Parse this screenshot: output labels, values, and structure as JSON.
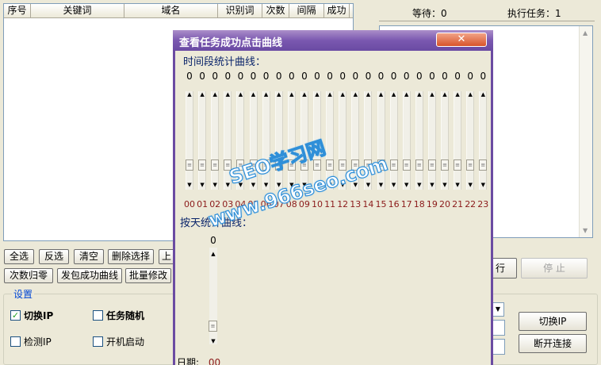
{
  "list": {
    "columns": [
      "序号",
      "关键词",
      "域名",
      "识别词",
      "次数",
      "间隔",
      "成功"
    ]
  },
  "status": {
    "waiting_label": "等待：0",
    "executing_label": "执行任务：1"
  },
  "buttons": {
    "select_all": "全选",
    "invert": "反选",
    "clear": "清空",
    "delete_selected": "删除选择",
    "up_partial": "上",
    "reset_count": "次数归零",
    "send_curve": "发包成功曲线",
    "batch_edit": "批量修改",
    "run_partial": "行",
    "stop": "停 止",
    "switch_ip": "切换IP",
    "disconnect": "断开连接"
  },
  "settings": {
    "title": "设置",
    "switch_ip": {
      "label": "切换IP",
      "checked": true
    },
    "task_random": {
      "label": "任务随机",
      "checked": false
    },
    "detect_ip": {
      "label": "检测IP",
      "checked": false
    },
    "autostart": {
      "label": "开机启动",
      "checked": false
    }
  },
  "dialog": {
    "title": "查看任务成功点击曲线",
    "close_icon": "close-icon",
    "time_section_label": "时间段统计曲线：",
    "day_section_label": "按天统计曲线：",
    "hours": [
      "00",
      "01",
      "02",
      "03",
      "04",
      "05",
      "06",
      "07",
      "08",
      "09",
      "10",
      "11",
      "12",
      "13",
      "14",
      "15",
      "16",
      "17",
      "18",
      "19",
      "20",
      "21",
      "22",
      "23"
    ],
    "hour_values": [
      "0",
      "0",
      "0",
      "0",
      "0",
      "0",
      "0",
      "0",
      "0",
      "0",
      "0",
      "0",
      "0",
      "0",
      "0",
      "0",
      "0",
      "0",
      "0",
      "0",
      "0",
      "0",
      "0",
      "0"
    ],
    "day_value": "0",
    "date_label": "日期:",
    "date_value": "00"
  },
  "watermark": {
    "line1": "SEO学习网",
    "line2": "www.966seo.com"
  },
  "colors": {
    "dialog_frame": "#6b4ba2",
    "hour_label": "#8b1a1a",
    "section_label": "#0a246a",
    "watermark_stroke": "#2f8fd8"
  }
}
